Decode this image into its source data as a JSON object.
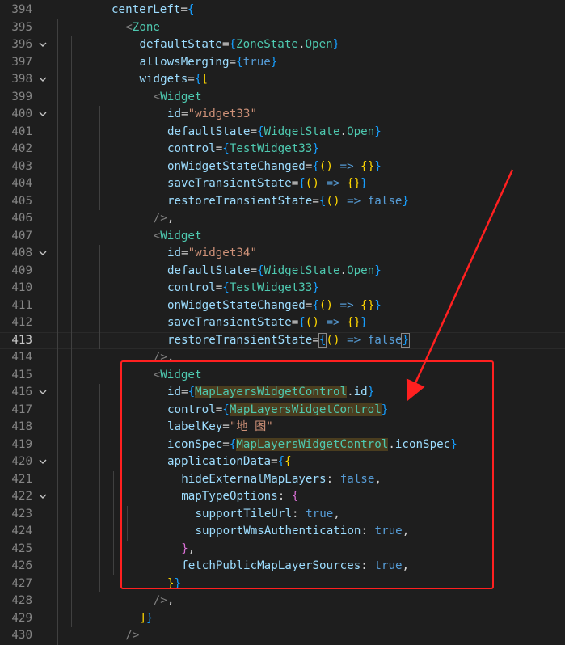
{
  "editor": {
    "lines": [
      {
        "n": "394",
        "fold": false,
        "indent": 0,
        "tokens": [
          [
            "t-attr",
            "centerLeft"
          ],
          [
            "t-p",
            "="
          ],
          [
            "t-b1",
            "{"
          ]
        ]
      },
      {
        "n": "395",
        "fold": false,
        "indent": 1,
        "tokens": [
          [
            "t-br",
            "<"
          ],
          [
            "t-tag",
            "Zone"
          ]
        ]
      },
      {
        "n": "396",
        "fold": true,
        "indent": 2,
        "tokens": [
          [
            "t-attr",
            "defaultState"
          ],
          [
            "t-p",
            "="
          ],
          [
            "t-b1",
            "{"
          ],
          [
            "t-cls",
            "ZoneState"
          ],
          [
            "t-p",
            "."
          ],
          [
            "t-cls",
            "Open"
          ],
          [
            "t-b1",
            "}"
          ]
        ]
      },
      {
        "n": "397",
        "fold": false,
        "indent": 2,
        "tokens": [
          [
            "t-attr",
            "allowsMerging"
          ],
          [
            "t-p",
            "="
          ],
          [
            "t-b1",
            "{"
          ],
          [
            "t-kw",
            "true"
          ],
          [
            "t-b1",
            "}"
          ]
        ]
      },
      {
        "n": "398",
        "fold": true,
        "indent": 2,
        "tokens": [
          [
            "t-attr",
            "widgets"
          ],
          [
            "t-p",
            "="
          ],
          [
            "t-b1",
            "{"
          ],
          [
            "t-y",
            "["
          ]
        ]
      },
      {
        "n": "399",
        "fold": false,
        "indent": 3,
        "tokens": [
          [
            "t-br",
            "<"
          ],
          [
            "t-tag",
            "Widget"
          ]
        ]
      },
      {
        "n": "400",
        "fold": true,
        "indent": 4,
        "tokens": [
          [
            "t-attr",
            "id"
          ],
          [
            "t-p",
            "="
          ],
          [
            "t-str",
            "\"widget33\""
          ]
        ]
      },
      {
        "n": "401",
        "fold": false,
        "indent": 4,
        "tokens": [
          [
            "t-attr",
            "defaultState"
          ],
          [
            "t-p",
            "="
          ],
          [
            "t-b1",
            "{"
          ],
          [
            "t-cls",
            "WidgetState"
          ],
          [
            "t-p",
            "."
          ],
          [
            "t-cls",
            "Open"
          ],
          [
            "t-b1",
            "}"
          ]
        ]
      },
      {
        "n": "402",
        "fold": false,
        "indent": 4,
        "tokens": [
          [
            "t-attr",
            "control"
          ],
          [
            "t-p",
            "="
          ],
          [
            "t-b1",
            "{"
          ],
          [
            "t-cls",
            "TestWidget33"
          ],
          [
            "t-b1",
            "}"
          ]
        ]
      },
      {
        "n": "403",
        "fold": false,
        "indent": 4,
        "tokens": [
          [
            "t-attr",
            "onWidgetStateChanged"
          ],
          [
            "t-p",
            "="
          ],
          [
            "t-b1",
            "{"
          ],
          [
            "t-y",
            "()"
          ],
          [
            "t-p",
            " "
          ],
          [
            "t-kw",
            "=>"
          ],
          [
            "t-p",
            " "
          ],
          [
            "t-y",
            "{}"
          ],
          [
            "t-b1",
            "}"
          ]
        ]
      },
      {
        "n": "404",
        "fold": false,
        "indent": 4,
        "tokens": [
          [
            "t-attr",
            "saveTransientState"
          ],
          [
            "t-p",
            "="
          ],
          [
            "t-b1",
            "{"
          ],
          [
            "t-y",
            "()"
          ],
          [
            "t-p",
            " "
          ],
          [
            "t-kw",
            "=>"
          ],
          [
            "t-p",
            " "
          ],
          [
            "t-y",
            "{}"
          ],
          [
            "t-b1",
            "}"
          ]
        ]
      },
      {
        "n": "405",
        "fold": false,
        "indent": 4,
        "tokens": [
          [
            "t-attr",
            "restoreTransientState"
          ],
          [
            "t-p",
            "="
          ],
          [
            "t-b1",
            "{"
          ],
          [
            "t-y",
            "()"
          ],
          [
            "t-p",
            " "
          ],
          [
            "t-kw",
            "=>"
          ],
          [
            "t-p",
            " "
          ],
          [
            "t-kw",
            "false"
          ],
          [
            "t-b1",
            "}"
          ]
        ]
      },
      {
        "n": "406",
        "fold": false,
        "indent": 3,
        "tokens": [
          [
            "t-br",
            "/>"
          ],
          [
            "t-p",
            ","
          ]
        ]
      },
      {
        "n": "407",
        "fold": false,
        "indent": 3,
        "tokens": [
          [
            "t-br",
            "<"
          ],
          [
            "t-tag",
            "Widget"
          ]
        ]
      },
      {
        "n": "408",
        "fold": true,
        "indent": 4,
        "tokens": [
          [
            "t-attr",
            "id"
          ],
          [
            "t-p",
            "="
          ],
          [
            "t-str",
            "\"widget34\""
          ]
        ]
      },
      {
        "n": "409",
        "fold": false,
        "indent": 4,
        "tokens": [
          [
            "t-attr",
            "defaultState"
          ],
          [
            "t-p",
            "="
          ],
          [
            "t-b1",
            "{"
          ],
          [
            "t-cls",
            "WidgetState"
          ],
          [
            "t-p",
            "."
          ],
          [
            "t-cls",
            "Open"
          ],
          [
            "t-b1",
            "}"
          ]
        ]
      },
      {
        "n": "410",
        "fold": false,
        "indent": 4,
        "tokens": [
          [
            "t-attr",
            "control"
          ],
          [
            "t-p",
            "="
          ],
          [
            "t-b1",
            "{"
          ],
          [
            "t-cls",
            "TestWidget33"
          ],
          [
            "t-b1",
            "}"
          ]
        ]
      },
      {
        "n": "411",
        "fold": false,
        "indent": 4,
        "tokens": [
          [
            "t-attr",
            "onWidgetStateChanged"
          ],
          [
            "t-p",
            "="
          ],
          [
            "t-b1",
            "{"
          ],
          [
            "t-y",
            "()"
          ],
          [
            "t-p",
            " "
          ],
          [
            "t-kw",
            "=>"
          ],
          [
            "t-p",
            " "
          ],
          [
            "t-y",
            "{}"
          ],
          [
            "t-b1",
            "}"
          ]
        ]
      },
      {
        "n": "412",
        "fold": false,
        "indent": 4,
        "tokens": [
          [
            "t-attr",
            "saveTransientState"
          ],
          [
            "t-p",
            "="
          ],
          [
            "t-b1",
            "{"
          ],
          [
            "t-y",
            "()"
          ],
          [
            "t-p",
            " "
          ],
          [
            "t-kw",
            "=>"
          ],
          [
            "t-p",
            " "
          ],
          [
            "t-y",
            "{}"
          ],
          [
            "t-b1",
            "}"
          ]
        ]
      },
      {
        "n": "413",
        "fold": false,
        "indent": 4,
        "current": true,
        "tokens": [
          [
            "t-attr",
            "restoreTransientState"
          ],
          [
            "t-p",
            "="
          ],
          [
            "t-b1 bracket-box",
            "{"
          ],
          [
            "t-y",
            "()"
          ],
          [
            "t-p",
            " "
          ],
          [
            "t-kw",
            "=>"
          ],
          [
            "t-p",
            " "
          ],
          [
            "t-kw",
            "false"
          ],
          [
            "t-b1 bracket-box",
            "}"
          ]
        ]
      },
      {
        "n": "414",
        "fold": false,
        "indent": 3,
        "tokens": [
          [
            "t-br",
            "/>"
          ],
          [
            "t-p",
            ","
          ]
        ]
      },
      {
        "n": "415",
        "fold": false,
        "indent": 3,
        "tokens": [
          [
            "t-br",
            "<"
          ],
          [
            "t-tag",
            "Widget"
          ]
        ]
      },
      {
        "n": "416",
        "fold": true,
        "indent": 4,
        "tokens": [
          [
            "t-attr",
            "id"
          ],
          [
            "t-p",
            "="
          ],
          [
            "t-b1",
            "{"
          ],
          [
            "t-cls hl",
            "MapLayersWidgetControl"
          ],
          [
            "t-p",
            "."
          ],
          [
            "t-attr",
            "id"
          ],
          [
            "t-b1",
            "}"
          ]
        ]
      },
      {
        "n": "417",
        "fold": false,
        "indent": 4,
        "tokens": [
          [
            "t-attr",
            "control"
          ],
          [
            "t-p",
            "="
          ],
          [
            "t-b1",
            "{"
          ],
          [
            "t-cls hl",
            "MapLayersWidgetControl"
          ],
          [
            "t-b1",
            "}"
          ]
        ]
      },
      {
        "n": "418",
        "fold": false,
        "indent": 4,
        "tokens": [
          [
            "t-attr",
            "labelKey"
          ],
          [
            "t-p",
            "="
          ],
          [
            "t-str",
            "\"地 图\""
          ]
        ]
      },
      {
        "n": "419",
        "fold": false,
        "indent": 4,
        "tokens": [
          [
            "t-attr",
            "iconSpec"
          ],
          [
            "t-p",
            "="
          ],
          [
            "t-b1",
            "{"
          ],
          [
            "t-cls hl",
            "MapLayersWidgetControl"
          ],
          [
            "t-p",
            "."
          ],
          [
            "t-attr",
            "iconSpec"
          ],
          [
            "t-b1",
            "}"
          ]
        ]
      },
      {
        "n": "420",
        "fold": true,
        "indent": 4,
        "tokens": [
          [
            "t-attr",
            "applicationData"
          ],
          [
            "t-p",
            "="
          ],
          [
            "t-b1",
            "{"
          ],
          [
            "t-y",
            "{"
          ]
        ]
      },
      {
        "n": "421",
        "fold": false,
        "indent": 5,
        "tokens": [
          [
            "t-attr",
            "hideExternalMapLayers"
          ],
          [
            "t-p",
            ": "
          ],
          [
            "t-kw",
            "false"
          ],
          [
            "t-p",
            ","
          ]
        ]
      },
      {
        "n": "422",
        "fold": true,
        "indent": 5,
        "tokens": [
          [
            "t-attr",
            "mapTypeOptions"
          ],
          [
            "t-p",
            ": "
          ],
          [
            "t-v",
            "{"
          ]
        ]
      },
      {
        "n": "423",
        "fold": false,
        "indent": 6,
        "tokens": [
          [
            "t-attr",
            "supportTileUrl"
          ],
          [
            "t-p",
            ": "
          ],
          [
            "t-kw",
            "true"
          ],
          [
            "t-p",
            ","
          ]
        ]
      },
      {
        "n": "424",
        "fold": false,
        "indent": 6,
        "tokens": [
          [
            "t-attr",
            "supportWmsAuthentication"
          ],
          [
            "t-p",
            ": "
          ],
          [
            "t-kw",
            "true"
          ],
          [
            "t-p",
            ","
          ]
        ]
      },
      {
        "n": "425",
        "fold": false,
        "indent": 5,
        "tokens": [
          [
            "t-v",
            "}"
          ],
          [
            "t-p",
            ","
          ]
        ]
      },
      {
        "n": "426",
        "fold": false,
        "indent": 5,
        "tokens": [
          [
            "t-attr",
            "fetchPublicMapLayerSources"
          ],
          [
            "t-p",
            ": "
          ],
          [
            "t-kw",
            "true"
          ],
          [
            "t-p",
            ","
          ]
        ]
      },
      {
        "n": "427",
        "fold": false,
        "indent": 4,
        "tokens": [
          [
            "t-y",
            "}"
          ],
          [
            "t-b1",
            "}"
          ]
        ]
      },
      {
        "n": "428",
        "fold": false,
        "indent": 3,
        "tokens": [
          [
            "t-br",
            "/>"
          ],
          [
            "t-p",
            ","
          ]
        ]
      },
      {
        "n": "429",
        "fold": false,
        "indent": 2,
        "tokens": [
          [
            "t-y",
            "]"
          ],
          [
            "t-b1",
            "}"
          ]
        ]
      },
      {
        "n": "430",
        "fold": false,
        "indent": 1,
        "tokens": [
          [
            "t-br",
            "/>"
          ]
        ]
      }
    ]
  },
  "colors": {
    "background": "#1e1e1e",
    "annotation": "#ff2020"
  },
  "icons": {
    "fold": "chevron-down-icon"
  }
}
